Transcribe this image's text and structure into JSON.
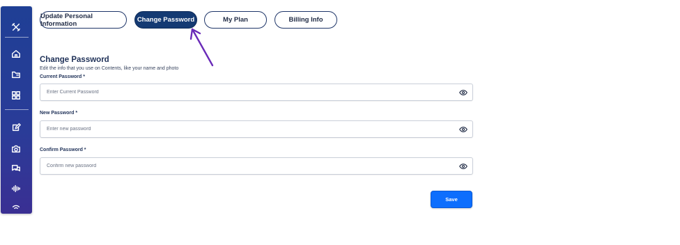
{
  "sidebar": {
    "icons": [
      "tools-icon",
      "home-icon",
      "folder-icon",
      "grid-icon",
      "edit-icon",
      "camera-icon",
      "chat-icon",
      "audio-wave-icon",
      "wifi-icon"
    ]
  },
  "tabs": [
    {
      "label": "Update Personal Information",
      "active": false
    },
    {
      "label": "Change Password",
      "active": true
    },
    {
      "label": "My Plan",
      "active": false
    },
    {
      "label": "Billing Info",
      "active": false
    }
  ],
  "section": {
    "title": "Change Password",
    "subtitle": "Edit the info that you use on Contents, like your name and photo"
  },
  "fields": {
    "current": {
      "label": "Current Password *",
      "placeholder": "Enter Current Password",
      "value": ""
    },
    "new": {
      "label": "New Password *",
      "placeholder": "Enter new password",
      "value": ""
    },
    "confirm": {
      "label": "Confirm Password *",
      "placeholder": "Confirm new password",
      "value": ""
    }
  },
  "save_label": "Save",
  "colors": {
    "sidebar": "#233d96",
    "active_tab": "#143a73",
    "save_button": "#0d6efd",
    "annotation_arrow": "#6a2bb8"
  }
}
